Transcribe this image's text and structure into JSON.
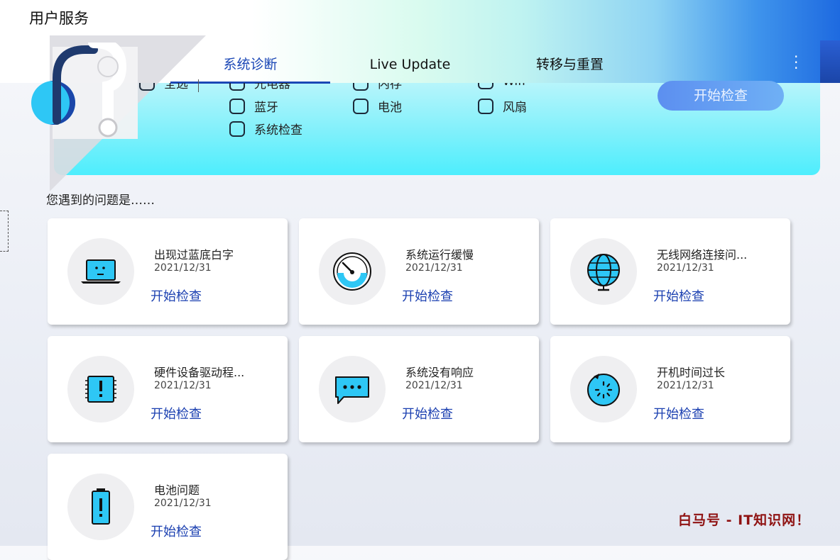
{
  "app": {
    "title": "用户服务"
  },
  "tabs": [
    {
      "label": "系统诊断",
      "active": true
    },
    {
      "label": "Live Update",
      "active": false
    },
    {
      "label": "转移与重置",
      "active": false
    }
  ],
  "diagnostics": {
    "checkboxes": [
      {
        "label": "全选",
        "checked": false
      },
      {
        "label": "光电器",
        "checked": false
      },
      {
        "label": "内存",
        "checked": false
      },
      {
        "label": "Wifi",
        "checked": false
      },
      {
        "label": "蓝牙",
        "checked": false
      },
      {
        "label": "电池",
        "checked": false
      },
      {
        "label": "风扇",
        "checked": false
      },
      {
        "label": "系统检查",
        "checked": false
      }
    ],
    "start_button": "开始检查"
  },
  "problems": {
    "heading": "您遇到的问题是……",
    "cards": [
      {
        "title": "出现过蓝底白字",
        "date": "2021/12/31",
        "action": "开始检查",
        "icon": "laptop-icon"
      },
      {
        "title": "系统运行缓慢",
        "date": "2021/12/31",
        "action": "开始检查",
        "icon": "speedometer-icon"
      },
      {
        "title": "无线网络连接问...",
        "date": "2021/12/31",
        "action": "开始检查",
        "icon": "globe-icon"
      },
      {
        "title": "硬件设备驱动程...",
        "date": "2021/12/31",
        "action": "开始检查",
        "icon": "chip-alert-icon"
      },
      {
        "title": "系统没有响应",
        "date": "2021/12/31",
        "action": "开始检查",
        "icon": "chat-bubble-icon"
      },
      {
        "title": "开机时间过长",
        "date": "2021/12/31",
        "action": "开始检查",
        "icon": "loading-clock-icon"
      },
      {
        "title": "电池问题",
        "date": "2021/12/31",
        "action": "开始检查",
        "icon": "battery-alert-icon"
      }
    ]
  },
  "watermark": "白马号 - IT知识网！",
  "colors": {
    "accent": "#1b47b6",
    "icon_fill": "#2ec7f5"
  }
}
